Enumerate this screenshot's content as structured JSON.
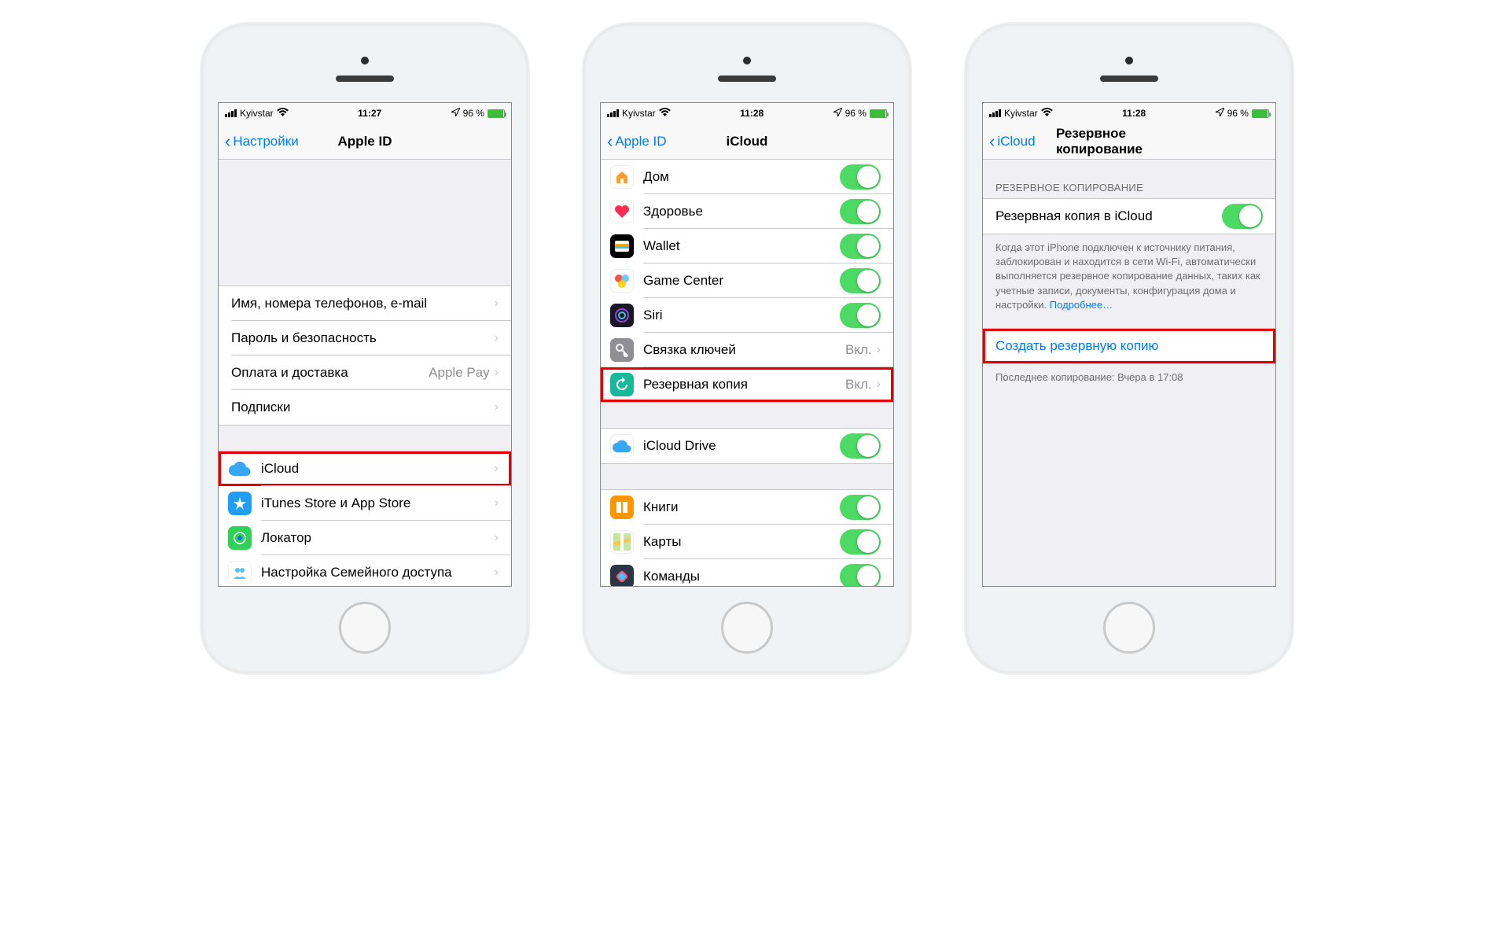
{
  "status": {
    "carrier": "Kyivstar",
    "battery_pct": "96 %"
  },
  "phone1": {
    "time": "11:27",
    "back": "Настройки",
    "title": "Apple ID",
    "group1": {
      "r1": {
        "label": "Имя, номера телефонов, e-mail"
      },
      "r2": {
        "label": "Пароль и безопасность"
      },
      "r3": {
        "label": "Оплата и доставка",
        "detail": "Apple Pay"
      },
      "r4": {
        "label": "Подписки"
      }
    },
    "group2": {
      "r1": {
        "label": "iCloud"
      },
      "r2": {
        "label": "iTunes Store и App Store"
      },
      "r3": {
        "label": "Локатор"
      },
      "r4": {
        "label": "Настройка Семейного доступа"
      }
    }
  },
  "phone2": {
    "time": "11:28",
    "back": "Apple ID",
    "title": "iCloud",
    "group1": {
      "r1": {
        "label": "Дом"
      },
      "r2": {
        "label": "Здоровье"
      },
      "r3": {
        "label": "Wallet"
      },
      "r4": {
        "label": "Game Center"
      },
      "r5": {
        "label": "Siri"
      },
      "r6": {
        "label": "Связка ключей",
        "detail": "Вкл."
      },
      "r7": {
        "label": "Резервная копия",
        "detail": "Вкл."
      }
    },
    "group2": {
      "r1": {
        "label": "iCloud Drive"
      }
    },
    "group3": {
      "r1": {
        "label": "Книги"
      },
      "r2": {
        "label": "Карты"
      },
      "r3": {
        "label": "Команды"
      }
    }
  },
  "phone3": {
    "time": "11:28",
    "back": "iCloud",
    "title": "Резервное копирование",
    "section_header": "Резервное копирование",
    "toggle_label": "Резервная копия в iCloud",
    "footer": "Когда этот iPhone подключен к источнику питания, заблокирован и находится в сети Wi-Fi, автоматически выполняется резервное копирование данных, таких как учетные записи, документы, конфигурация дома и настройки.",
    "footer_link": "Подробнее…",
    "action": "Создать резервную копию",
    "last_backup": "Последнее копирование: Вчера в 17:08"
  }
}
